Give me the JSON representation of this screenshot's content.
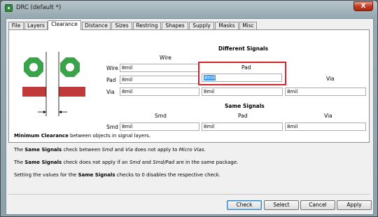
{
  "window": {
    "title": "DRC (default *)",
    "close_glyph": "X"
  },
  "tabs": [
    "File",
    "Layers",
    "Clearance",
    "Distance",
    "Sizes",
    "Restring",
    "Shapes",
    "Supply",
    "Masks",
    "Misc"
  ],
  "active_tab": "Clearance",
  "different_signals": {
    "title": "Different Signals",
    "col_wire": "Wire",
    "col_pad": "Pad",
    "col_via": "Via",
    "wire_row": {
      "label": "Wire",
      "wire": "8mil"
    },
    "pad_row": {
      "label": "Pad",
      "wire": "8mil",
      "pad": "8mil"
    },
    "via_row": {
      "label": "Via",
      "wire": "8mil",
      "pad": "8mil",
      "via": "8mil"
    }
  },
  "same_signals": {
    "title": "Same Signals",
    "col_smd": "Smd",
    "col_pad": "Pad",
    "col_via": "Via",
    "smd_row": {
      "label": "Smd",
      "smd": "8mil",
      "pad": "8mil",
      "via": "8mil"
    }
  },
  "info": {
    "line1_bold": "Minimum Clearance",
    "line1_rest": " between objects in signal layers.",
    "line2_a": "The ",
    "line2_b": "Same Signals",
    "line2_c": " check between ",
    "line2_d": "Smd",
    "line2_e": " and ",
    "line2_f": "Via",
    "line2_g": " does not apply to ",
    "line2_h": "Micro Vias",
    "line2_i": ".",
    "line3_a": "The ",
    "line3_b": "Same Signals",
    "line3_c": " check does not apply if an ",
    "line3_d": "Smd",
    "line3_e": " and ",
    "line3_f": "Smd/Pad",
    "line3_g": " are in the same package.",
    "line4_a": "Setting the values for the ",
    "line4_b": "Same Signals",
    "line4_c": " checks to 0 disables the respective check."
  },
  "buttons": {
    "check": "Check",
    "select": "Select",
    "cancel": "Cancel",
    "apply": "Apply"
  },
  "colors": {
    "pad_green": "#3aa34a",
    "trace_red": "#c0393b",
    "focus_red": "#d8232a",
    "selection": "#3399ff"
  }
}
